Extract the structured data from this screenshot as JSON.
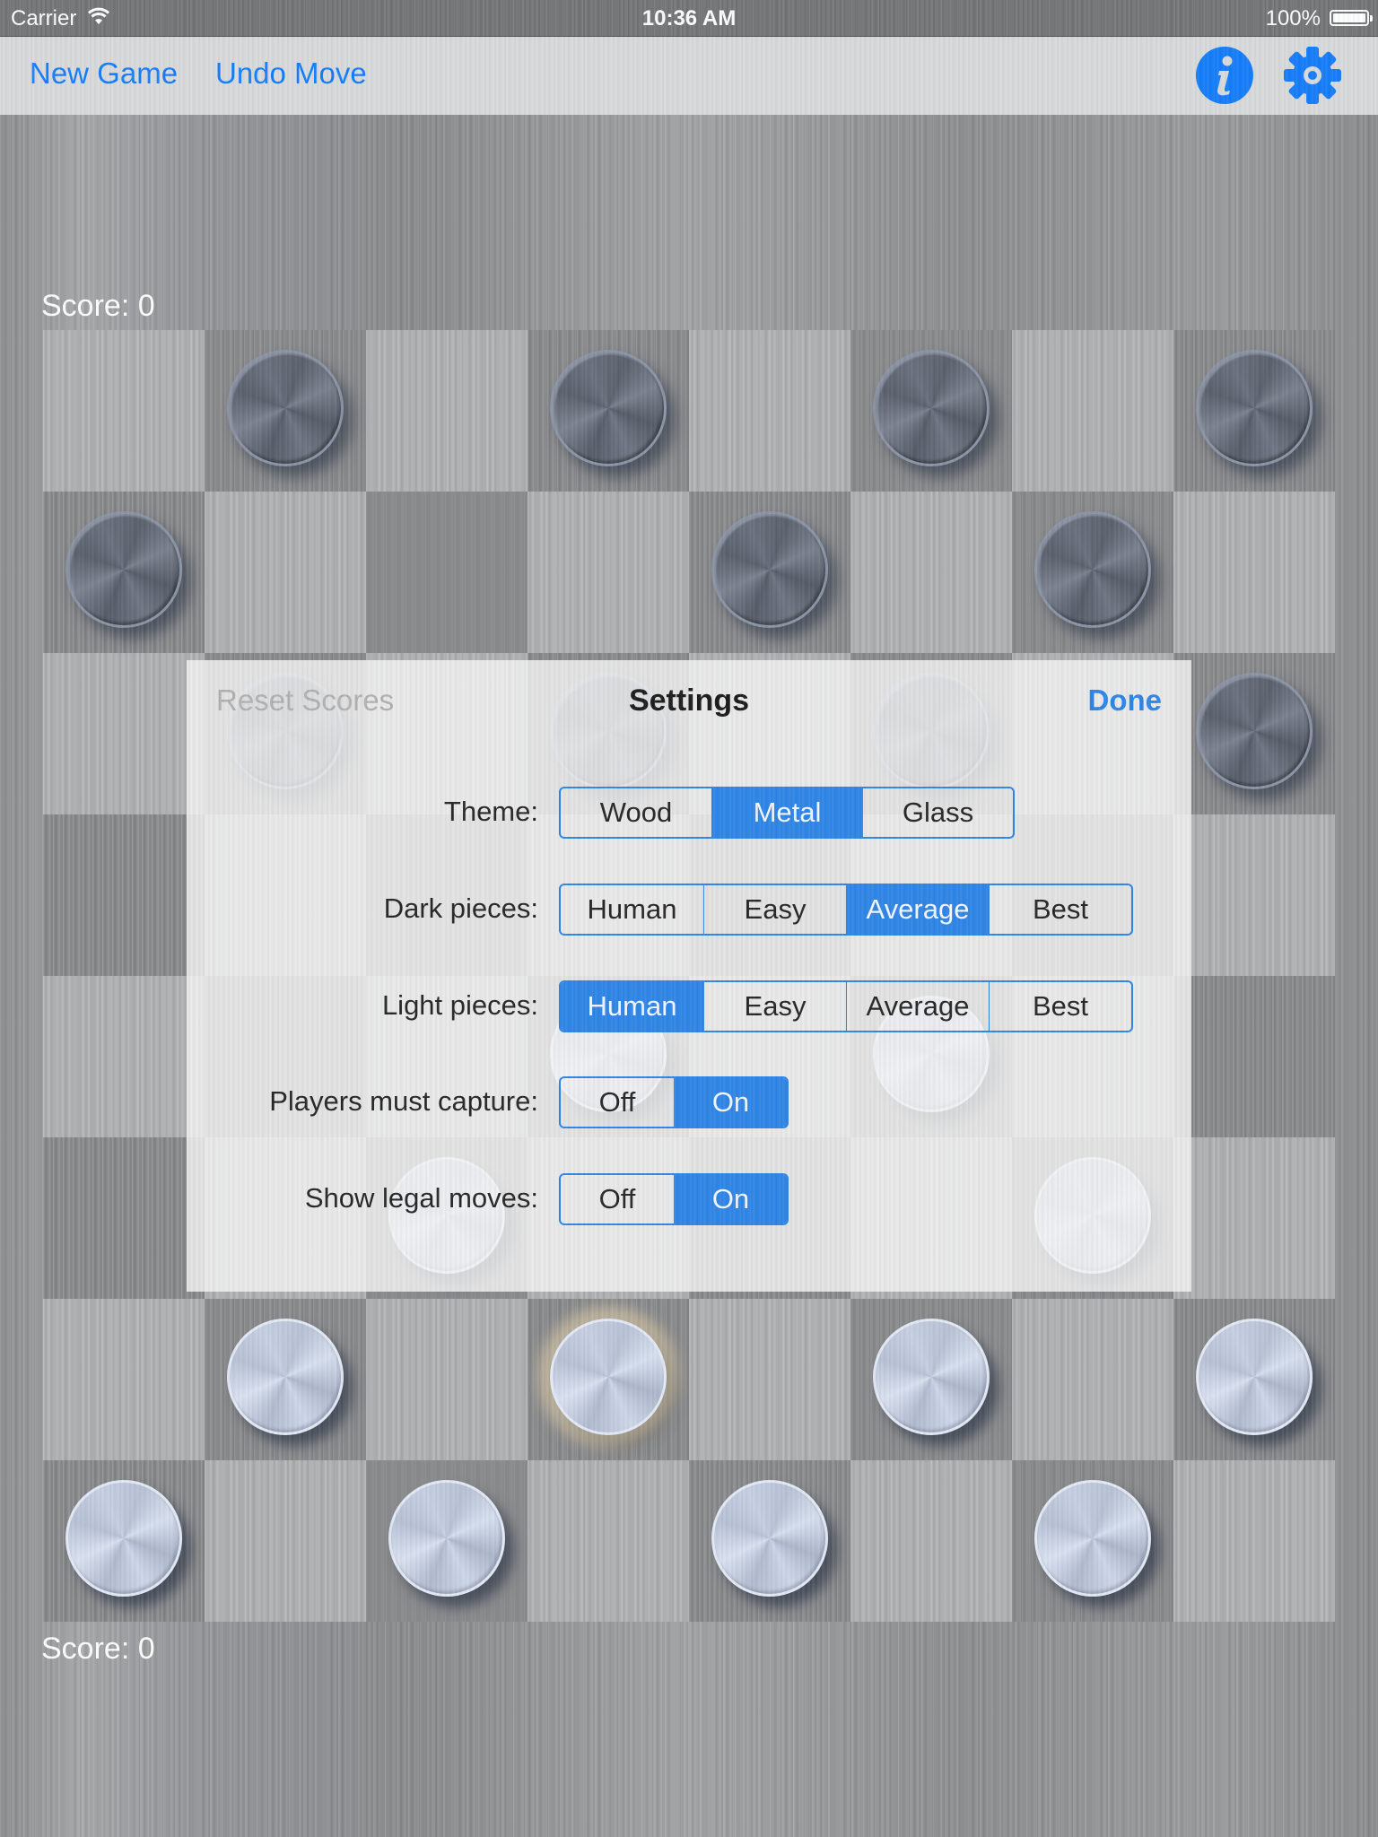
{
  "status_bar": {
    "carrier": "Carrier",
    "time": "10:36 AM",
    "battery_percent": "100%",
    "icons": [
      "wifi-icon",
      "battery-icon"
    ]
  },
  "toolbar": {
    "new_game_label": "New Game",
    "undo_move_label": "Undo Move",
    "info_icon": "info-icon",
    "settings_icon": "gear-icon",
    "accent_color": "#157efb"
  },
  "scores": {
    "top": "Score: 0",
    "bottom": "Score: 0"
  },
  "board": {
    "size": 8,
    "pieces": [
      {
        "row": 0,
        "col": 1,
        "color": "dark"
      },
      {
        "row": 0,
        "col": 3,
        "color": "dark"
      },
      {
        "row": 0,
        "col": 5,
        "color": "dark"
      },
      {
        "row": 0,
        "col": 7,
        "color": "dark"
      },
      {
        "row": 1,
        "col": 0,
        "color": "dark"
      },
      {
        "row": 1,
        "col": 4,
        "color": "dark"
      },
      {
        "row": 1,
        "col": 6,
        "color": "dark"
      },
      {
        "row": 2,
        "col": 1,
        "color": "dark"
      },
      {
        "row": 2,
        "col": 3,
        "color": "dark"
      },
      {
        "row": 2,
        "col": 5,
        "color": "dark"
      },
      {
        "row": 2,
        "col": 7,
        "color": "dark"
      },
      {
        "row": 4,
        "col": 3,
        "color": "light"
      },
      {
        "row": 4,
        "col": 5,
        "color": "light"
      },
      {
        "row": 5,
        "col": 2,
        "color": "light"
      },
      {
        "row": 5,
        "col": 6,
        "color": "light"
      },
      {
        "row": 6,
        "col": 1,
        "color": "light"
      },
      {
        "row": 6,
        "col": 3,
        "color": "light",
        "selected": true
      },
      {
        "row": 6,
        "col": 5,
        "color": "light"
      },
      {
        "row": 6,
        "col": 7,
        "color": "light"
      },
      {
        "row": 7,
        "col": 0,
        "color": "light"
      },
      {
        "row": 7,
        "col": 2,
        "color": "light"
      },
      {
        "row": 7,
        "col": 4,
        "color": "light"
      },
      {
        "row": 7,
        "col": 6,
        "color": "light"
      }
    ]
  },
  "settings": {
    "title": "Settings",
    "reset_scores_label": "Reset Scores",
    "reset_scores_enabled": false,
    "done_label": "Done",
    "accent_color": "#2f86e8",
    "rows": {
      "theme": {
        "label": "Theme:",
        "options": [
          "Wood",
          "Metal",
          "Glass"
        ],
        "selected": "Metal"
      },
      "dark_pieces": {
        "label": "Dark pieces:",
        "options": [
          "Human",
          "Easy",
          "Average",
          "Best"
        ],
        "selected": "Average"
      },
      "light_pieces": {
        "label": "Light pieces:",
        "options": [
          "Human",
          "Easy",
          "Average",
          "Best"
        ],
        "selected": "Human"
      },
      "players_must_capture": {
        "label": "Players must capture:",
        "options": [
          "Off",
          "On"
        ],
        "selected": "On"
      },
      "show_legal_moves": {
        "label": "Show legal moves:",
        "options": [
          "Off",
          "On"
        ],
        "selected": "On"
      }
    }
  }
}
